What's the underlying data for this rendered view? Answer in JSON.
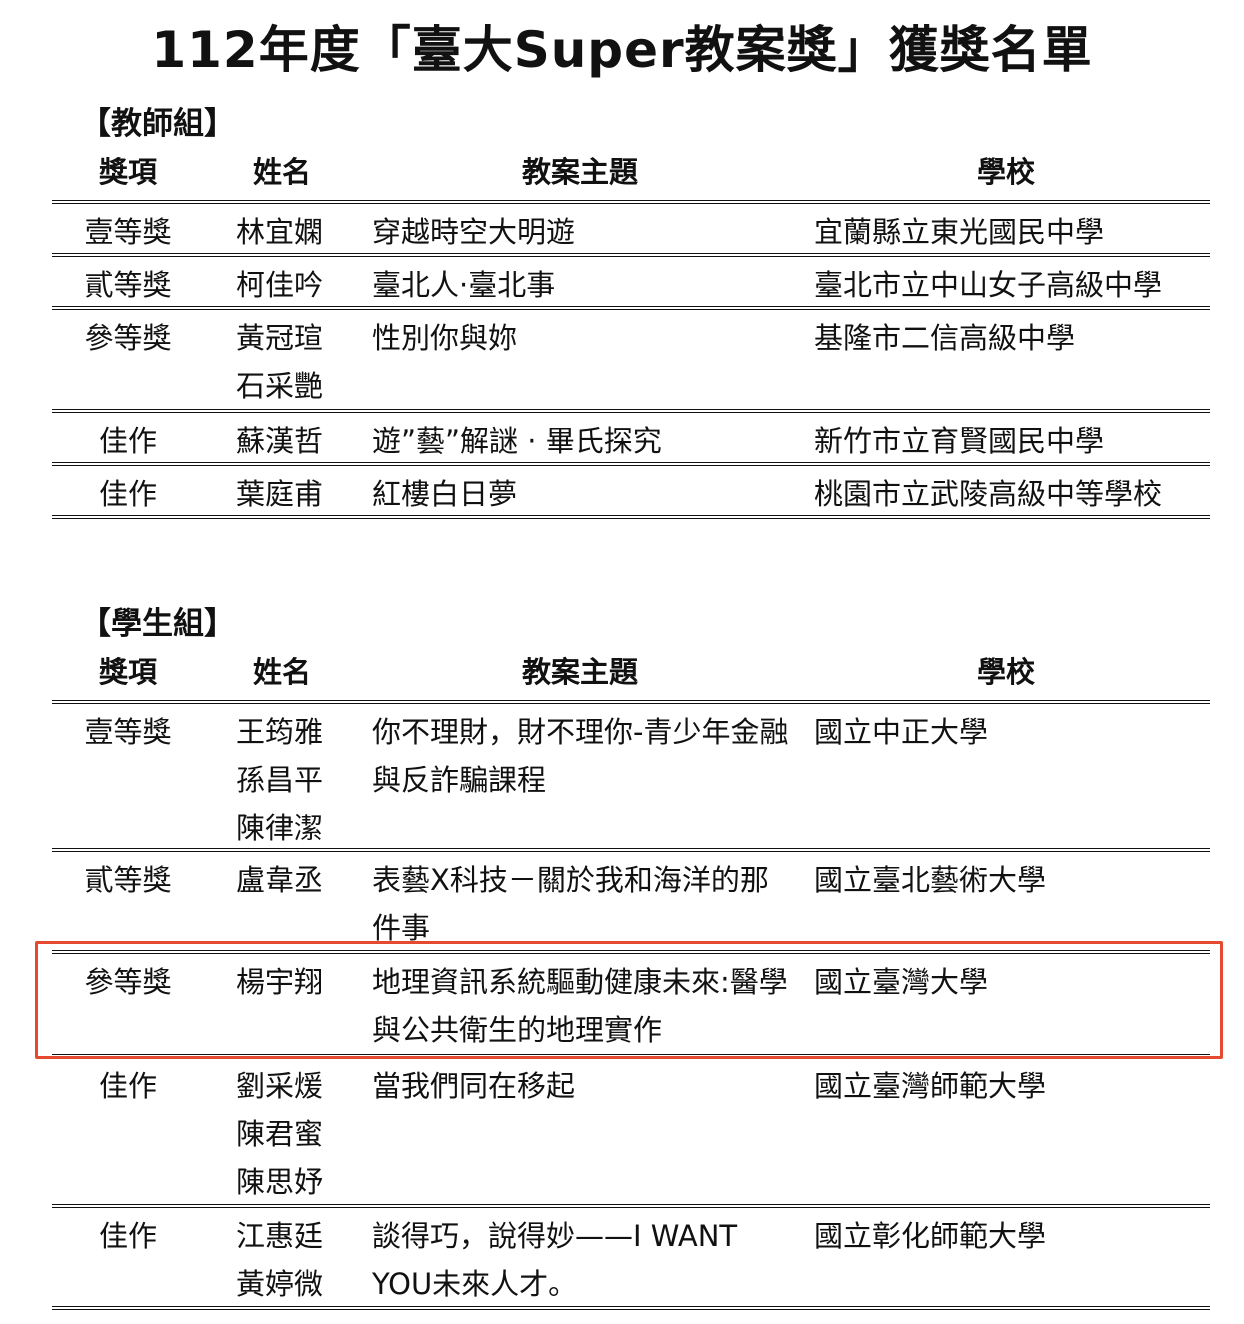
{
  "title": "112年度「臺大Super教案獎」獲獎名單",
  "columns": {
    "award": "獎項",
    "name": "姓名",
    "topic": "教案主題",
    "school": "學校"
  },
  "highlight_color": "#e5492f",
  "teacher_group": {
    "label": "【教師組】",
    "rows": [
      {
        "award": "壹等獎",
        "names": [
          "林宜嫻"
        ],
        "topic": "穿越時空大明遊",
        "school": "宜蘭縣立東光國民中學"
      },
      {
        "award": "貳等獎",
        "names": [
          "柯佳吟"
        ],
        "topic": "臺北人·臺北事",
        "school": "臺北市立中山女子高級中學"
      },
      {
        "award": "參等獎",
        "names": [
          "黃冠瑄",
          "石采艷"
        ],
        "topic": "性別你與妳",
        "school": "基隆市二信高級中學"
      },
      {
        "award": "佳作",
        "names": [
          "蘇漢哲"
        ],
        "topic": "遊”藝”解謎 · 畢氏探究",
        "school": "新竹市立育賢國民中學"
      },
      {
        "award": "佳作",
        "names": [
          "葉庭甫"
        ],
        "topic": "紅樓白日夢",
        "school": "桃園市立武陵高級中等學校"
      }
    ]
  },
  "student_group": {
    "label": "【學生組】",
    "rows": [
      {
        "award": "壹等獎",
        "names": [
          "王筠雅",
          "孫昌平",
          "陳律潔"
        ],
        "topic": "你不理財，財不理你-青少年金融與反詐騙課程",
        "school": "國立中正大學"
      },
      {
        "award": "貳等獎",
        "names": [
          "盧韋丞"
        ],
        "topic": "表藝X科技－關於我和海洋的那件事",
        "school": "國立臺北藝術大學"
      },
      {
        "award": "參等獎",
        "names": [
          "楊宇翔"
        ],
        "topic": "地理資訊系統驅動健康未來:醫學與公共衛生的地理實作",
        "school": "國立臺灣大學"
      },
      {
        "award": "佳作",
        "names": [
          "劉采煖",
          "陳君蜜",
          "陳思妤"
        ],
        "topic": "當我們同在移起",
        "school": "國立臺灣師範大學"
      },
      {
        "award": "佳作",
        "names": [
          "江惠廷",
          "黃婷微"
        ],
        "topic": "談得巧，說得妙——I WANT YOU未來人才。",
        "school": "國立彰化師範大學"
      }
    ]
  }
}
